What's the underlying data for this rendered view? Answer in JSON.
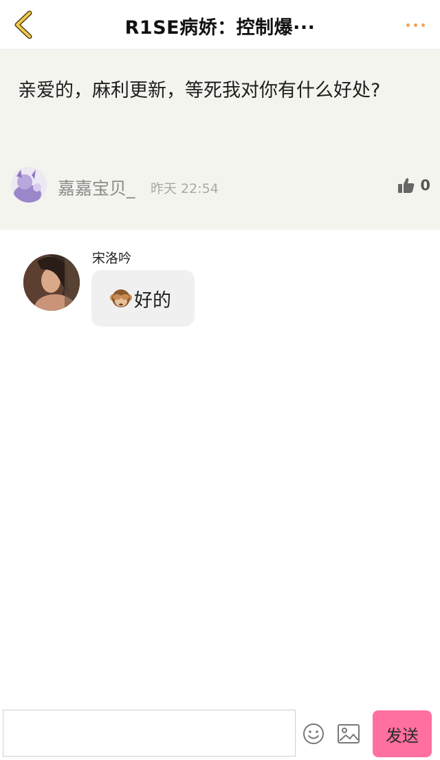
{
  "header": {
    "title": "R1SE病娇：控制爆···",
    "back_icon": "chevron-left-icon",
    "more_icon": "more-dots-icon",
    "accent_color": "#f0a35a"
  },
  "post": {
    "text": "亲爱的，麻利更新，等死我对你有什么好处?",
    "author": "嘉嘉宝贝_",
    "time": "昨天 22:54",
    "like_icon": "thumbs-up-icon",
    "like_count": "0"
  },
  "comments": [
    {
      "name": "宋洛吟",
      "emoji": "see-no-evil-monkey-icon",
      "text": "好的"
    }
  ],
  "input_bar": {
    "input_value": "",
    "emoji_icon": "smiley-icon",
    "image_icon": "image-icon",
    "send_label": "发送",
    "send_color": "#ff6fa0"
  }
}
